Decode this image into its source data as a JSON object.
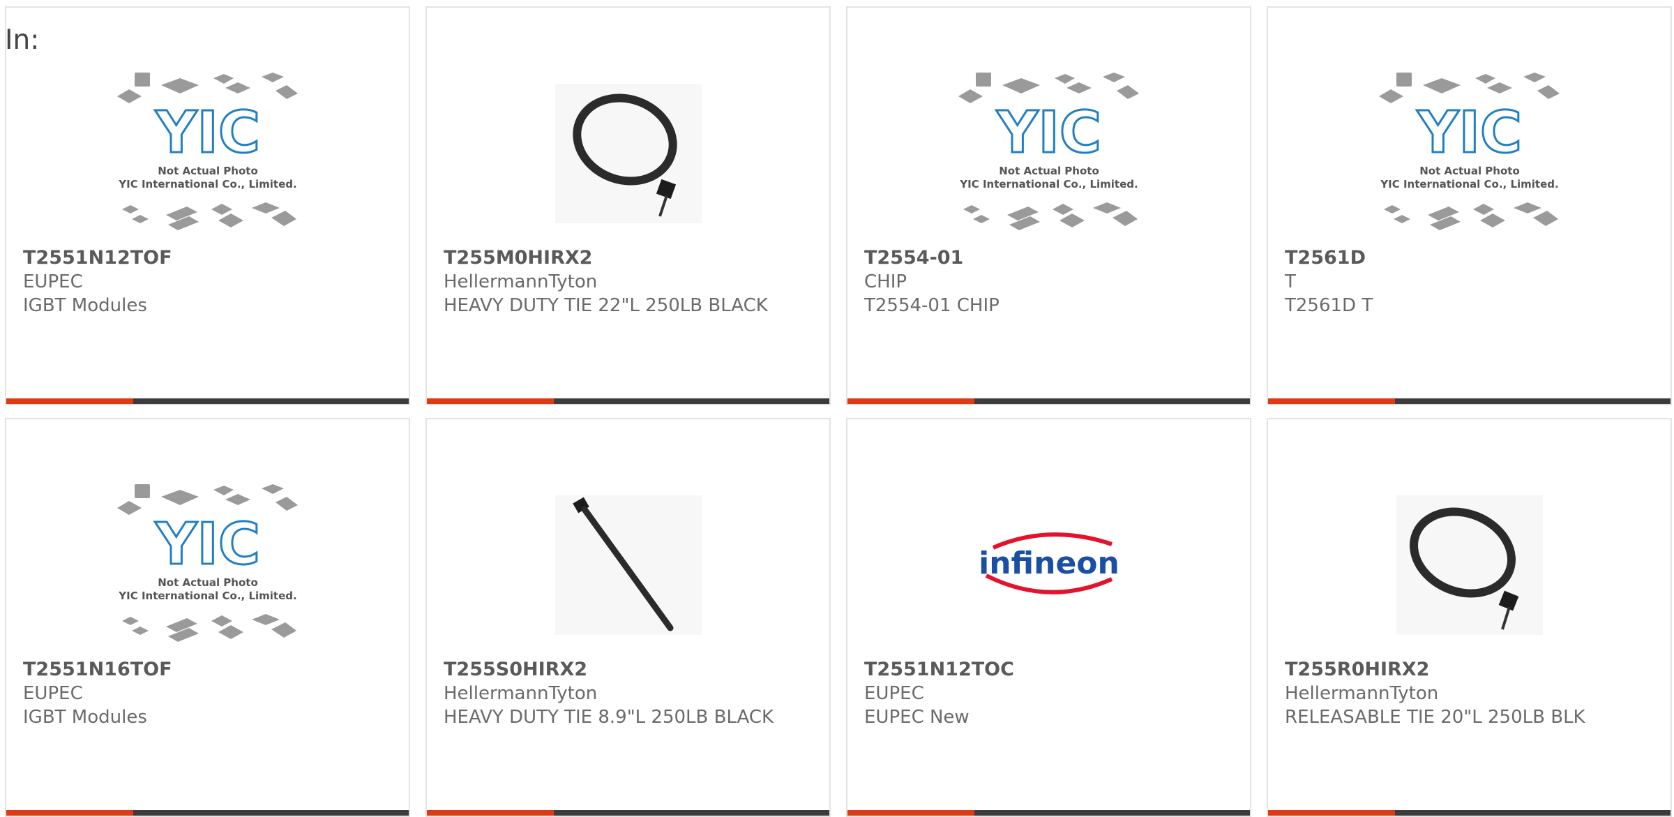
{
  "header": {
    "in_label": "In:"
  },
  "placeholder": {
    "logo_text": "YIC",
    "line1": "Not Actual Photo",
    "line2": "YIC International Co., Limited."
  },
  "brand_logo_text": "infineon",
  "colors": {
    "accent": "#e03a14",
    "bar": "#3c3c3c",
    "yic_blue": "#1f7fc4",
    "infineon_blue": "#1a4fa3",
    "infineon_red": "#e3132c"
  },
  "products": [
    {
      "part": "T2551N12TOF",
      "maker": "EUPEC",
      "desc": "IGBT Modules",
      "image": "yic-placeholder"
    },
    {
      "part": "T255M0HIRX2",
      "maker": "HellermannTyton",
      "desc": "HEAVY DUTY TIE 22\"L 250LB BLACK",
      "image": "cable-tie-loop"
    },
    {
      "part": "T2554-01",
      "maker": "CHIP",
      "desc": "T2554-01 CHIP",
      "image": "yic-placeholder"
    },
    {
      "part": "T2561D",
      "maker": "T",
      "desc": "T2561D T",
      "image": "yic-placeholder"
    },
    {
      "part": "T2551N16TOF",
      "maker": "EUPEC",
      "desc": "IGBT Modules",
      "image": "yic-placeholder"
    },
    {
      "part": "T255S0HIRX2",
      "maker": "HellermannTyton",
      "desc": "HEAVY DUTY TIE 8.9\"L 250LB BLACK",
      "image": "cable-tie-straight"
    },
    {
      "part": "T2551N12TOC",
      "maker": "EUPEC",
      "desc": "EUPEC New",
      "image": "infineon-logo"
    },
    {
      "part": "T255R0HIRX2",
      "maker": "HellermannTyton",
      "desc": "RELEASABLE TIE 20\"L 250LB BLK",
      "image": "cable-tie-loop"
    }
  ]
}
